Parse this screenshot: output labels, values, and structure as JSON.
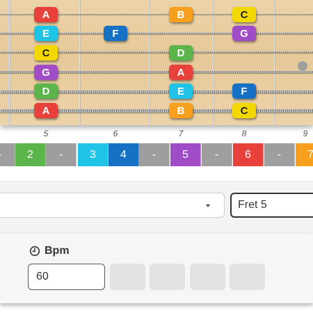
{
  "fretboard": {
    "notes": [
      {
        "label": "A",
        "color": "#e8413c"
      },
      {
        "label": "E",
        "color": "#1fc3e6"
      },
      {
        "label": "C",
        "color": "#f3d800"
      },
      {
        "label": "G",
        "color": "#a04cc6"
      },
      {
        "label": "D",
        "color": "#5bb54b"
      },
      {
        "label": "A",
        "color": "#e8413c"
      },
      {
        "label": "F",
        "color": "#1670c4"
      },
      {
        "label": "B",
        "color": "#f7a01d"
      },
      {
        "label": "D",
        "color": "#5bb54b"
      },
      {
        "label": "A",
        "color": "#e8413c"
      },
      {
        "label": "E",
        "color": "#1fc3e6"
      },
      {
        "label": "B",
        "color": "#f7a01d"
      },
      {
        "label": "C",
        "color": "#f3d800"
      },
      {
        "label": "G",
        "color": "#a04cc6"
      },
      {
        "label": "F",
        "color": "#1670c4"
      },
      {
        "label": "C",
        "color": "#f3d800"
      }
    ],
    "fret_numbers": [
      "5",
      "6",
      "7",
      "8",
      "9"
    ]
  },
  "degree_strip": [
    {
      "label": "-",
      "color": "#9e9e9e"
    },
    {
      "label": "2",
      "color": "#5bb54b"
    },
    {
      "label": "-",
      "color": "#9e9e9e"
    },
    {
      "label": "3",
      "color": "#1fc3e6"
    },
    {
      "label": "4",
      "color": "#1670c4"
    },
    {
      "label": "-",
      "color": "#9e9e9e"
    },
    {
      "label": "5",
      "color": "#a04cc6"
    },
    {
      "label": "-",
      "color": "#9e9e9e"
    },
    {
      "label": "6",
      "color": "#e8413c"
    },
    {
      "label": "-",
      "color": "#9e9e9e"
    },
    {
      "label": "7",
      "color": "#f7a01d"
    }
  ],
  "controls": {
    "main_select_value": "",
    "main_select_icon": "caret-down-icon",
    "fret_select_value": "Fret 5"
  },
  "bpm": {
    "label": "Bpm",
    "icon": "clock-icon",
    "value": "60"
  }
}
